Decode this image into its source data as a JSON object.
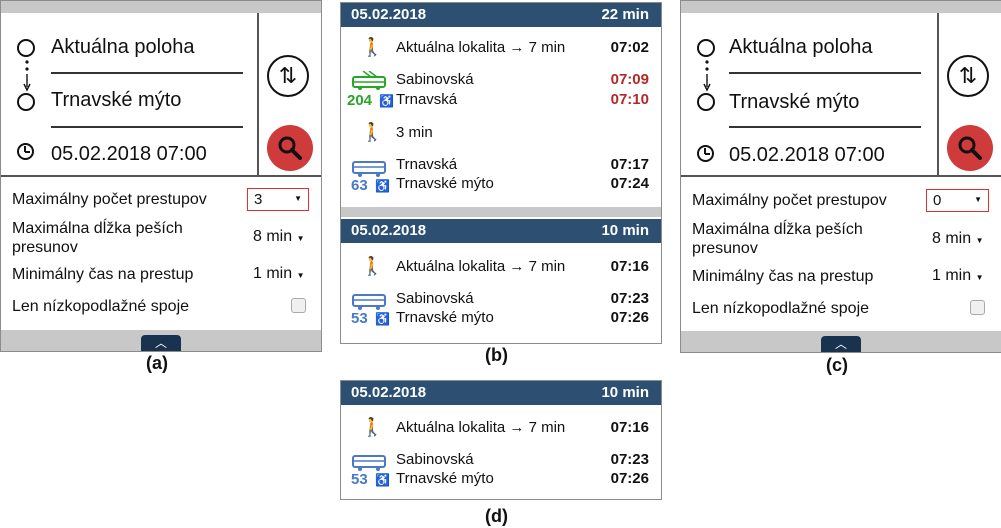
{
  "colors": {
    "header_bg": "#2d5072",
    "search_button": "#cf3b3b",
    "trolleybus": "#2aa52a",
    "bus": "#4a79c9",
    "delayed_time": "#b42828",
    "highlight_border": "#e03030"
  },
  "panel_a": {
    "from": "Aktuálna poloha",
    "to": "Trnavské mýto",
    "datetime": "05.02.2018 07:00",
    "options": {
      "max_transfers_label": "Maximálny počet prestupov",
      "max_transfers_value": "3",
      "max_walk_label": "Maximálna dĺžka peších presunov",
      "max_walk_value": "8 min",
      "min_transfer_label": "Minimálny čas na prestup",
      "min_transfer_value": "1 min",
      "low_floor_label": "Len nízkopodlažné spoje"
    },
    "caption": "(a)"
  },
  "panel_c": {
    "from": "Aktuálna poloha",
    "to": "Trnavské mýto",
    "datetime": "05.02.2018 07:00",
    "options": {
      "max_transfers_label": "Maximálny počet prestupov",
      "max_transfers_value": "0",
      "max_walk_label": "Maximálna dĺžka peších presunov",
      "max_walk_value": "8 min",
      "min_transfer_label": "Minimálny čas na prestup",
      "min_transfer_value": "1 min",
      "low_floor_label": "Len nízkopodlažné spoje"
    },
    "caption": "(c)"
  },
  "panel_b": {
    "caption": "(b)",
    "result1": {
      "date": "05.02.2018",
      "duration": "22 min",
      "walk1_text": "Aktuálna lokalita → 7 min",
      "walk1_time": "07:02",
      "ride1_line": "204",
      "ride1_from": "Sabinovská",
      "ride1_from_time": "07:09",
      "ride1_to": "Trnavská",
      "ride1_to_time": "07:10",
      "walk2_text": "3 min",
      "ride2_line": "63",
      "ride2_from": "Trnavská",
      "ride2_from_time": "07:17",
      "ride2_to": "Trnavské mýto",
      "ride2_to_time": "07:24"
    },
    "result2": {
      "date": "05.02.2018",
      "duration": "10 min",
      "walk_text": "Aktuálna lokalita → 7 min",
      "walk_time": "07:16",
      "ride_line": "53",
      "ride_from": "Sabinovská",
      "ride_from_time": "07:23",
      "ride_to": "Trnavské mýto",
      "ride_to_time": "07:26"
    }
  },
  "panel_d": {
    "caption": "(d)",
    "date": "05.02.2018",
    "duration": "10 min",
    "walk_text": "Aktuálna lokalita → 7 min",
    "walk_time": "07:16",
    "ride_line": "53",
    "ride_from": "Sabinovská",
    "ride_from_time": "07:23",
    "ride_to": "Trnavské mýto",
    "ride_to_time": "07:26"
  }
}
